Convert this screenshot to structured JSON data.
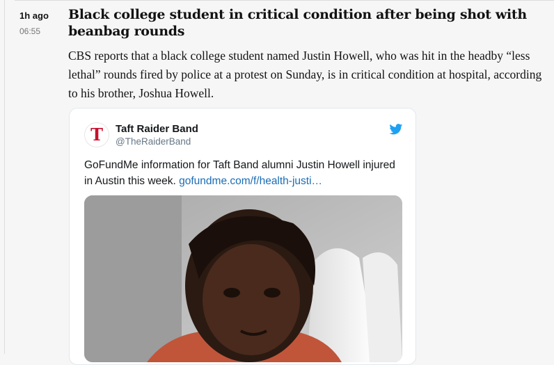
{
  "entry": {
    "relative_time": "1h ago",
    "clock_time": "06:55",
    "headline": "Black college student in critical condition after being shot with beanbag rounds",
    "body": "CBS reports that a black college student named Justin Howell, who was hit in the headby “less lethal” rounds fired by police at a protest on Sunday, is in critical condition at hospital, according to his brother, Joshua Howell."
  },
  "tweet": {
    "avatar_glyph": "T",
    "display_name": "Taft Raider Band",
    "handle": "@TheRaiderBand",
    "text": "GoFundMe information for Taft Band alumni Justin Howell injured in Austin this week. ",
    "link_text": "gofundme.com/f/health-justi…",
    "brand_icon": "twitter-bird-icon",
    "media_icon": "photo-of-person"
  },
  "colors": {
    "page_bg": "#f6f6f6",
    "text": "#121212",
    "muted": "#767676",
    "link": "#1b6cb5",
    "twitter_blue": "#1da1f2",
    "avatar_red": "#c8102e"
  }
}
